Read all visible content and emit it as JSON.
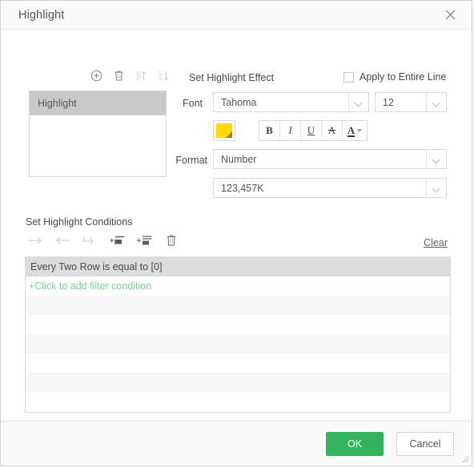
{
  "window": {
    "title": "Highlight",
    "close_icon": "close-icon"
  },
  "list_toolbar": {
    "items": [
      {
        "icon": "add-circle-icon",
        "label": "Add",
        "enabled": true
      },
      {
        "icon": "trash-icon",
        "label": "Delete",
        "enabled": true
      },
      {
        "icon": "sort-ascending-icon",
        "label": "Move Up",
        "enabled": false
      },
      {
        "icon": "sort-descending-icon",
        "label": "Move Down",
        "enabled": false
      }
    ]
  },
  "highlight_list": {
    "items": [
      {
        "label": "Highlight",
        "selected": true
      }
    ]
  },
  "effect": {
    "section_title": "Set Highlight Effect",
    "apply_entire_line": {
      "label": "Apply to Entire Line",
      "checked": false
    },
    "font_label": "Font",
    "font_value": "Tahoma",
    "font_size_value": "12",
    "fill_color": "#ffd900",
    "style_buttons": [
      {
        "icon": "bold-icon",
        "glyph": "B"
      },
      {
        "icon": "italic-icon",
        "glyph": "I"
      },
      {
        "icon": "underline-icon",
        "glyph": "U"
      },
      {
        "icon": "strikethrough-icon",
        "glyph": "A"
      },
      {
        "icon": "font-color-icon",
        "glyph": "A"
      }
    ],
    "format_label": "Format",
    "format_value": "Number",
    "format_pattern_value": "123,457K"
  },
  "conditions": {
    "section_title": "Set Highlight Conditions",
    "toolbar": [
      {
        "icon": "arrow-right-icon",
        "label": "Indent",
        "enabled": false
      },
      {
        "icon": "arrow-left-icon",
        "label": "Outdent",
        "enabled": false
      },
      {
        "icon": "arrow-turn-icon",
        "label": "Move",
        "enabled": false
      },
      {
        "icon": "add-condition-icon",
        "label": "Add Condition",
        "enabled": true
      },
      {
        "icon": "add-group-icon",
        "label": "Add Group",
        "enabled": true
      },
      {
        "icon": "trash-icon",
        "label": "Delete",
        "enabled": true
      }
    ],
    "clear_label": "Clear",
    "rows": [
      {
        "text": "Every Two Row is equal to [0]",
        "type": "header"
      },
      {
        "text": "+Click to add filter condition",
        "type": "add"
      },
      {
        "text": "",
        "type": "odd"
      },
      {
        "text": "",
        "type": "even"
      },
      {
        "text": "",
        "type": "odd"
      },
      {
        "text": "",
        "type": "even"
      },
      {
        "text": "",
        "type": "odd"
      },
      {
        "text": "",
        "type": "even"
      }
    ]
  },
  "editor": {
    "field_value": "Every Two Row",
    "verb_value": "is",
    "operator_value": "=",
    "operand_value": "0",
    "more_icon": "caret-down-icon"
  },
  "footer": {
    "ok_label": "OK",
    "cancel_label": "Cancel",
    "ok_color": "#33b45c",
    "grip_icon": "resize-grip-icon"
  }
}
